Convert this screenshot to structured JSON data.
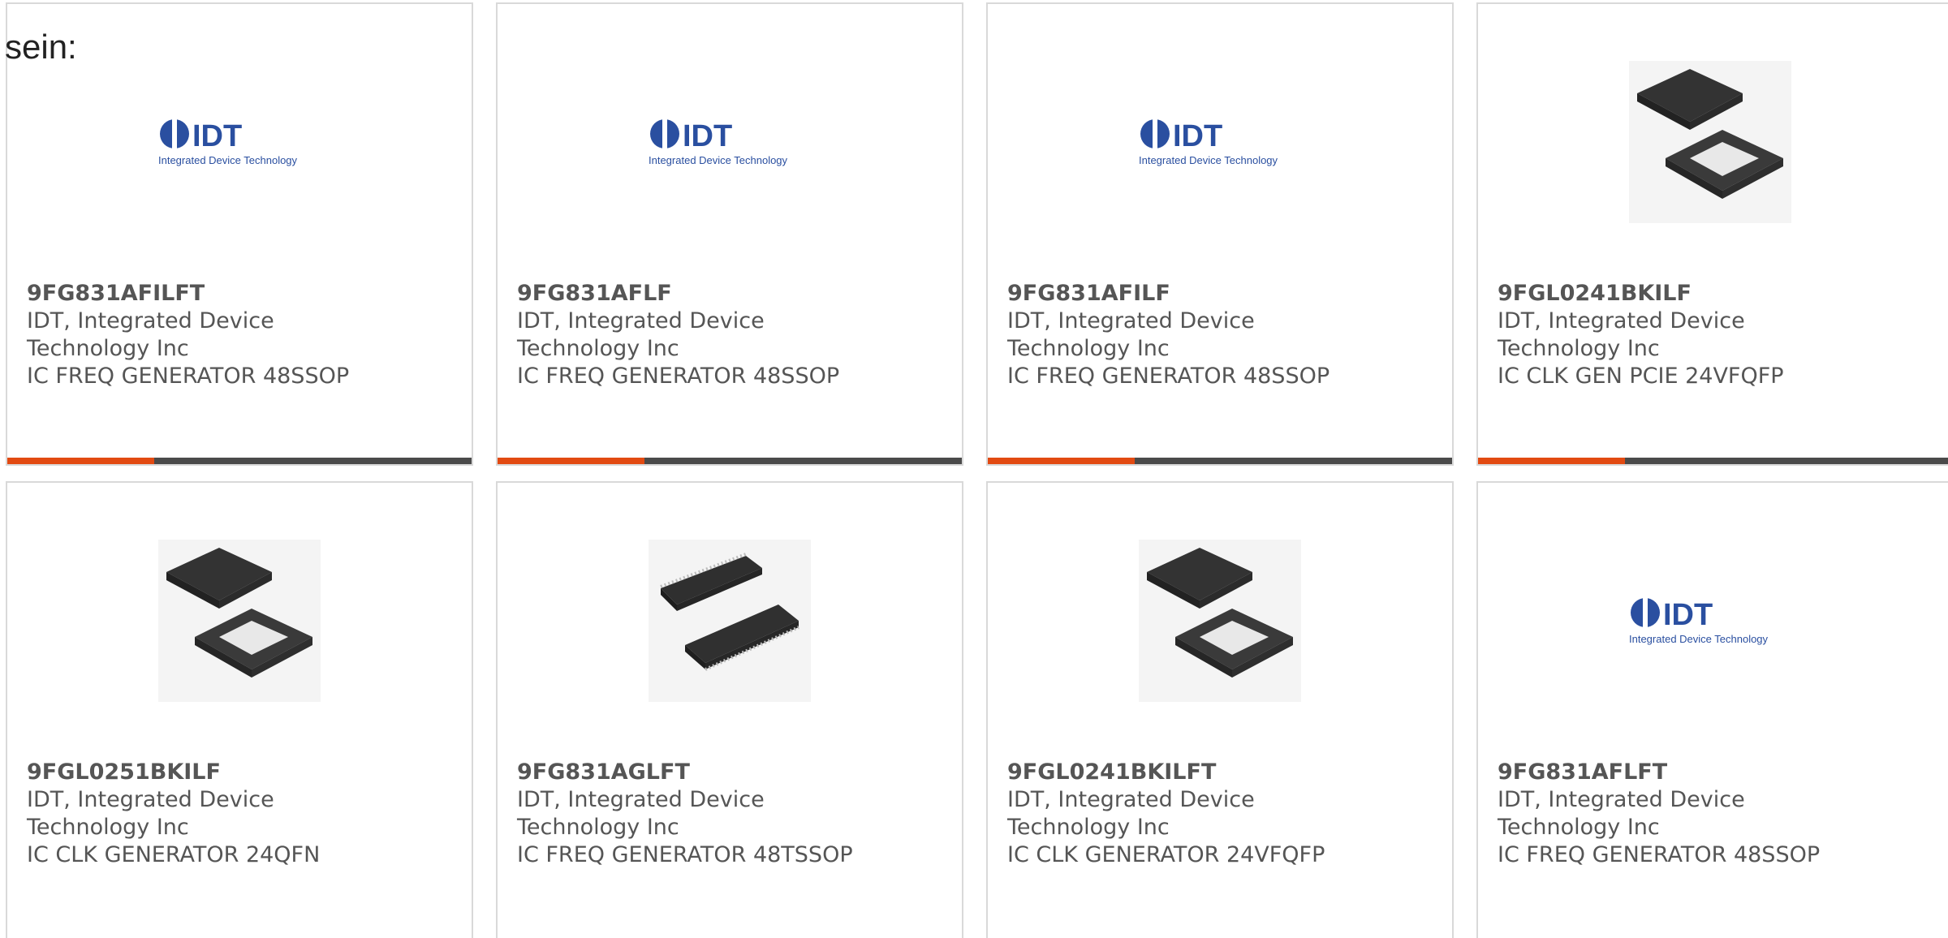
{
  "intro_text": "sein:",
  "colors": {
    "accent_bar": "#e24a12",
    "dark_bar": "#4a4a4a",
    "idt_logo_blue": "#2a4fa0",
    "chip_body": "#3a3a3a"
  },
  "products": [
    {
      "image": "idt-logo",
      "logo_text": "IDT",
      "logo_subtext": "Integrated Device Technology",
      "part_number": "9FG831AFILFT",
      "manufacturer_line1": "IDT, Integrated Device",
      "manufacturer_line2": "Technology Inc",
      "description": "IC FREQ GENERATOR 48SSOP"
    },
    {
      "image": "idt-logo",
      "logo_text": "IDT",
      "logo_subtext": "Integrated Device Technology",
      "part_number": "9FG831AFLF",
      "manufacturer_line1": "IDT, Integrated Device",
      "manufacturer_line2": "Technology Inc",
      "description": "IC FREQ GENERATOR 48SSOP"
    },
    {
      "image": "idt-logo",
      "logo_text": "IDT",
      "logo_subtext": "Integrated Device Technology",
      "part_number": "9FG831AFILF",
      "manufacturer_line1": "IDT, Integrated Device",
      "manufacturer_line2": "Technology Inc",
      "description": "IC FREQ GENERATOR 48SSOP"
    },
    {
      "image": "qfn-chip",
      "part_number": "9FGL0241BKILF",
      "manufacturer_line1": "IDT, Integrated Device",
      "manufacturer_line2": "Technology Inc",
      "description": "IC CLK GEN PCIE 24VFQFP"
    },
    {
      "image": "qfn-chip",
      "part_number": "9FGL0251BKILF",
      "manufacturer_line1": "IDT, Integrated Device",
      "manufacturer_line2": "Technology Inc",
      "description": "IC CLK GENERATOR 24QFN"
    },
    {
      "image": "tssop-chip",
      "part_number": "9FG831AGLFT",
      "manufacturer_line1": "IDT, Integrated Device",
      "manufacturer_line2": "Technology Inc",
      "description": "IC FREQ GENERATOR 48TSSOP"
    },
    {
      "image": "qfn-chip",
      "part_number": "9FGL0241BKILFT",
      "manufacturer_line1": "IDT, Integrated Device",
      "manufacturer_line2": "Technology Inc",
      "description": "IC CLK GENERATOR 24VFQFP"
    },
    {
      "image": "idt-logo",
      "logo_text": "IDT",
      "logo_subtext": "Integrated Device Technology",
      "part_number": "9FG831AFLFT",
      "manufacturer_line1": "IDT, Integrated Device",
      "manufacturer_line2": "Technology Inc",
      "description": "IC FREQ GENERATOR 48SSOP"
    }
  ]
}
